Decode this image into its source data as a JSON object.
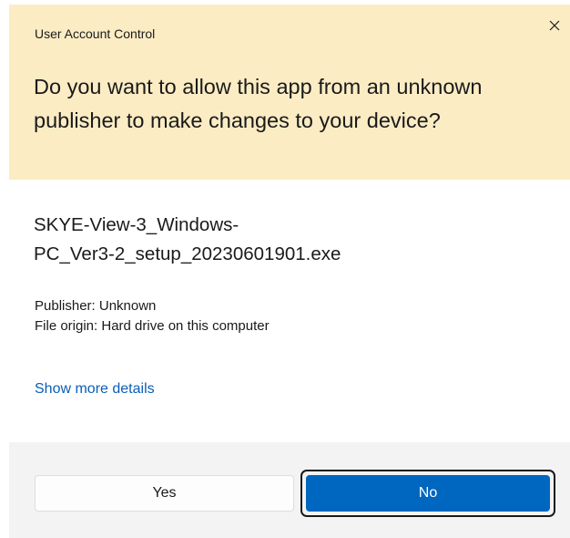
{
  "dialog": {
    "title": "User Account Control",
    "close_icon": "close-icon",
    "question": "Do you want to allow this app from an unknown publisher to make changes to your device?",
    "filename_line1": "SKYE-View-3_Windows-",
    "filename_line2": "PC_Ver3-2_setup_20230601901.exe",
    "publisher": "Publisher: Unknown",
    "file_origin": "File origin: Hard drive on this computer",
    "details_link": "Show more details",
    "yes_label": "Yes",
    "no_label": "No"
  },
  "colors": {
    "header_bg": "#fbecc4",
    "footer_bg": "#f3f3f3",
    "accent": "#0067c0",
    "link": "#0a5fb4"
  }
}
